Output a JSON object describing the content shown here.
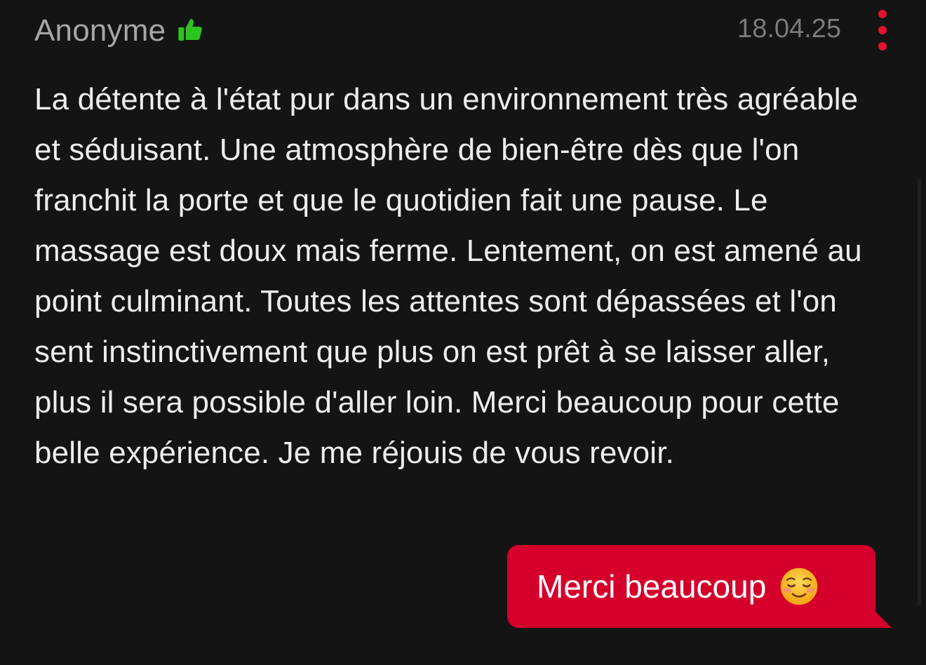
{
  "review": {
    "author": "Anonyme",
    "rating_icon": "thumbs-up-icon",
    "date": "18.04.25",
    "menu_icon": "more-vertical-icon",
    "text": "La détente à l'état pur dans un environnement très agréable et séduisant. Une atmosphère de bien-être dès que l'on franchit la porte et que le quotidien fait une pause. Le massage est doux mais ferme. Lentement, on est amené au point culminant. Toutes les attentes sont dépassées et l'on sent instinctivement que plus on est prêt à se laisser aller, plus il sera possible d'aller loin. Merci beaucoup pour cette belle expérience. Je me réjouis de vous revoir."
  },
  "reply": {
    "text": "Merci beaucoup",
    "emoji_icon": "smiling-face-emoji-icon"
  },
  "colors": {
    "background": "#141414",
    "author": "#a6a6a6",
    "date": "#7a7a7a",
    "body": "#ededed",
    "thumb_green": "#2ec41f",
    "accent_red": "#e4112f",
    "reply_bubble": "#d4002b"
  }
}
